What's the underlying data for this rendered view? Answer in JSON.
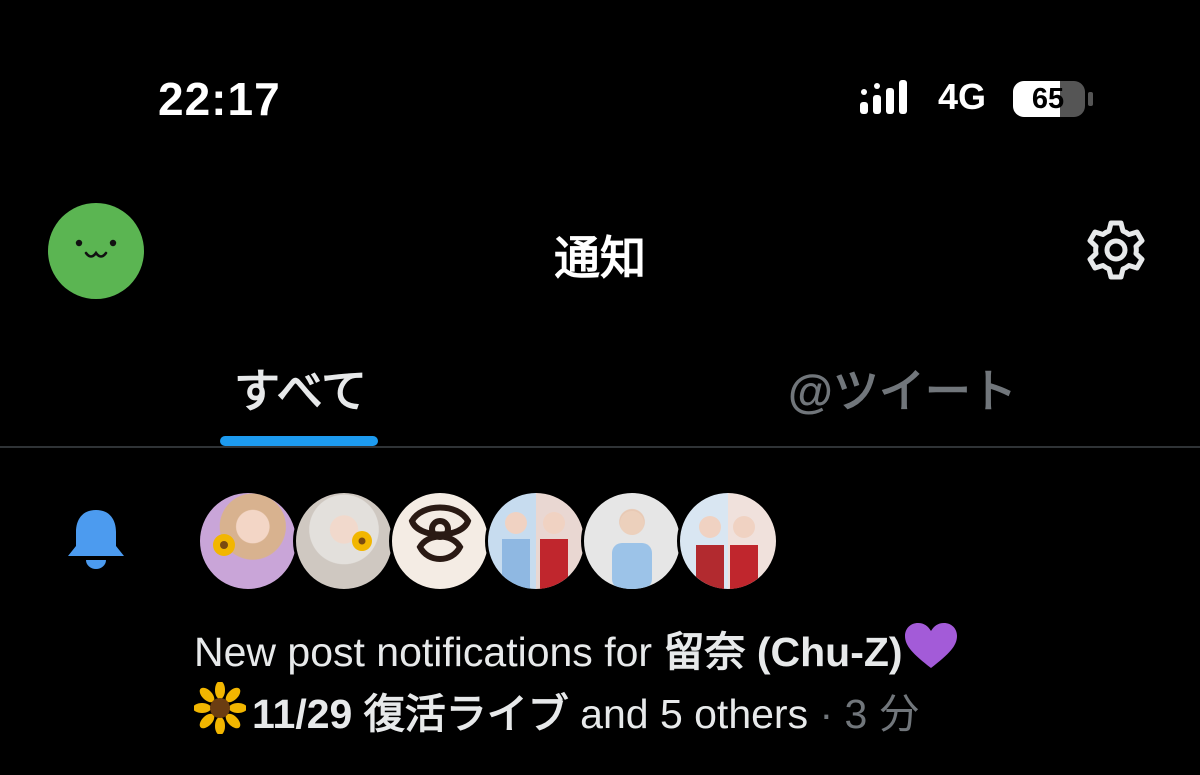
{
  "status_bar": {
    "time": "22:17",
    "network": "4G",
    "battery": "65",
    "icons": [
      "signal-icon",
      "battery-icon"
    ]
  },
  "header": {
    "title": "通知",
    "icons": [
      "profile-avatar",
      "gear-icon"
    ]
  },
  "tabs": [
    {
      "label": "すべて",
      "selected": true
    },
    {
      "label": "@ツイート",
      "selected": false
    }
  ],
  "colors": {
    "accent": "#1d9bf0",
    "avatar_green": "#5bb552",
    "muted": "#71767b",
    "heart": "#a35bd8",
    "sunflower": "#f2b600"
  },
  "notification": {
    "icon": "bell-icon",
    "avatar_count": 6,
    "text_prefix": "New post notifications for ",
    "user_name": "留奈 (Chu-Z)",
    "name_emoji": "purple-heart-icon",
    "line_emoji": "sunflower-icon",
    "user_name_cont": "11/29 復活ライブ",
    "others": "and 5 others",
    "separator": " · ",
    "time": "3 分"
  }
}
